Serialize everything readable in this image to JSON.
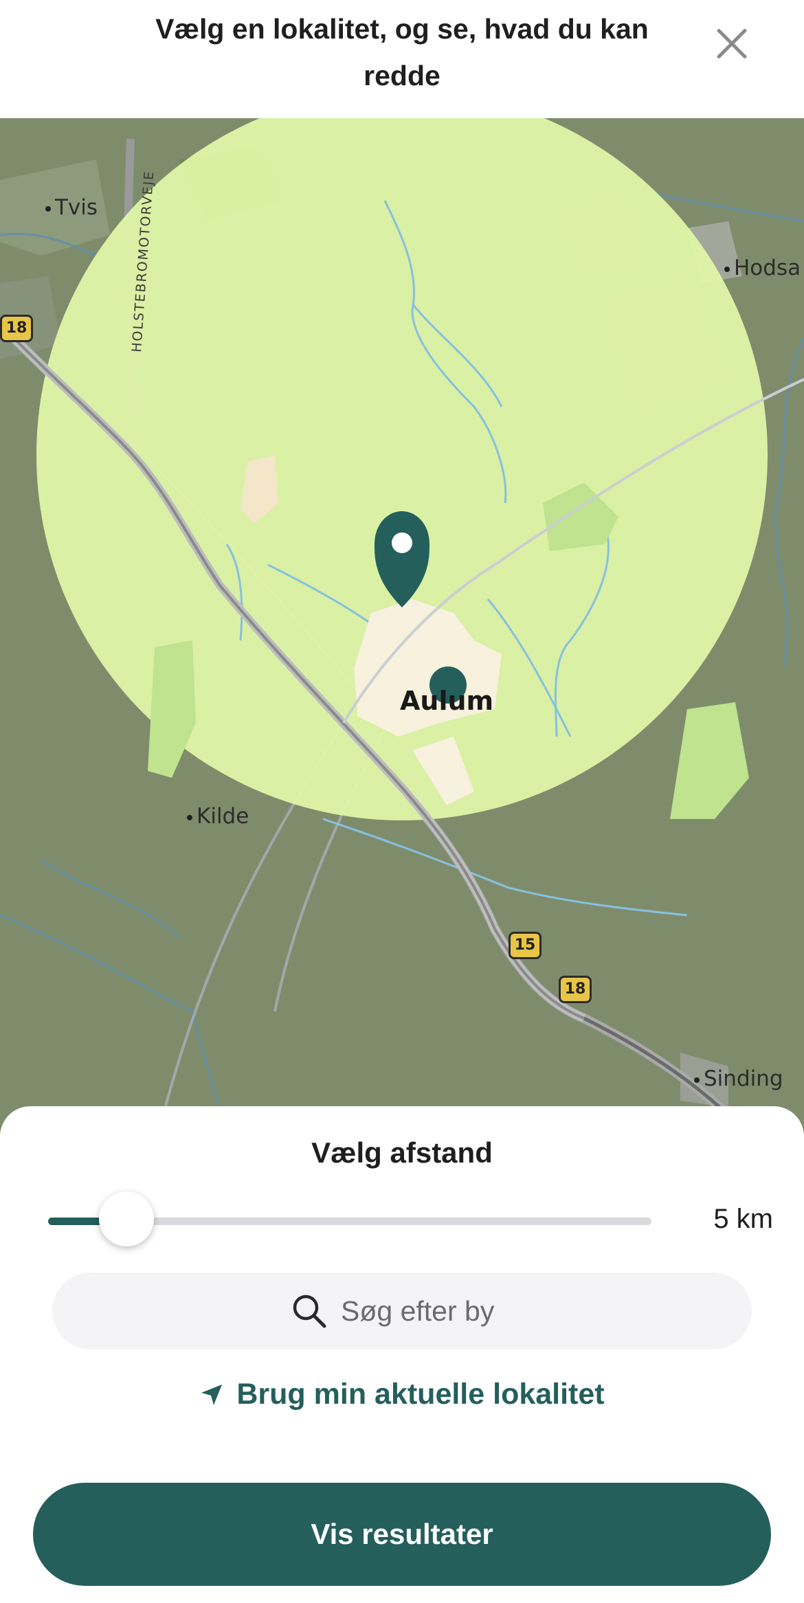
{
  "header": {
    "title": "Vælg en lokalitet, og se, hvad du kan redde",
    "close_icon": "close-icon"
  },
  "map": {
    "center_town": "Aulum",
    "places": [
      "Tvis",
      "Hodsa",
      "Kilde",
      "Sinding"
    ],
    "road_name": "HOLSTEBROMOTORVEJE",
    "road_shields": [
      "18",
      "15",
      "18"
    ],
    "radius_color": "#e1f7a8",
    "pin_color": "#245f5c"
  },
  "sheet": {
    "title": "Vælg afstand",
    "distance": {
      "value_label": "5 km",
      "fraction": 0.13
    },
    "search": {
      "placeholder": "Søg efter by",
      "icon": "search-icon"
    },
    "use_location": {
      "label": "Brug min aktuelle lokalitet",
      "icon": "navigation-arrow-icon"
    },
    "cta_label": "Vis resultater"
  },
  "colors": {
    "accent": "#245f5c",
    "track": "#d9d9de"
  }
}
